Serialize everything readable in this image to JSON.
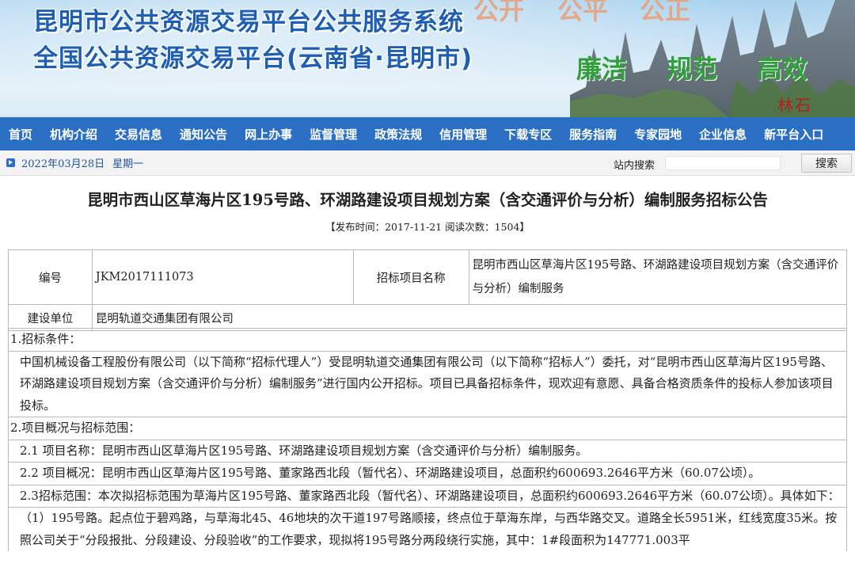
{
  "banner": {
    "title_line1": "昆明市公共资源交易平台公共服务系统",
    "title_line2": "全国公共资源交易平台(云南省·昆明市)",
    "motto": [
      "公开",
      "公平",
      "公正"
    ],
    "virtues": [
      "廉洁",
      "规范",
      "高效"
    ],
    "stamp": "林石"
  },
  "nav": {
    "items": [
      "首页",
      "机构介绍",
      "交易信息",
      "通知公告",
      "网上办事",
      "监督管理",
      "政策法规",
      "信用管理",
      "下载专区",
      "服务指南",
      "专家园地",
      "企业信息",
      "新平台入口"
    ]
  },
  "datebar": {
    "date": "2022年03月28日",
    "weekday": "星期一",
    "search_label": "站内搜索",
    "search_value": "",
    "search_button": "搜索"
  },
  "article": {
    "title": "昆明市西山区草海片区195号路、环湖路建设项目规划方案（含交通评价与分析）编制服务招标公告",
    "meta": "【发布时间：2017-11-21 阅读次数：1504】"
  },
  "table": {
    "number_label": "编号",
    "number_value": "JKM2017111073",
    "project_label": "招标项目名称",
    "project_value": "昆明市西山区草海片区195号路、环湖路建设项目规划方案（含交通评价与分析）编制服务",
    "builder_label": "建设单位",
    "builder_value": "昆明轨道交通集团有限公司"
  },
  "content": {
    "s1_heading": "1.招标条件：",
    "s1_body": "中国机械设备工程股份有限公司（以下简称“招标代理人”）受昆明轨道交通集团有限公司（以下简称“招标人”）委托，对“昆明市西山区草海片区195号路、环湖路建设项目规划方案（含交通评价与分析）编制服务”进行国内公开招标。项目已具备招标条件，现欢迎有意愿、具备合格资质条件的投标人参加该项目投标。",
    "s2_heading": "2.项目概况与招标范围：",
    "s2_1": "2.1 项目名称：昆明市西山区草海片区195号路、环湖路建设项目规划方案（含交通评价与分析）编制服务。",
    "s2_2": "2.2 项目概况：昆明市西山区草海片区195号路、董家路西北段（暂代名）、环湖路建设项目，总面积约600693.2646平方米（60.07公顷）。",
    "s2_3": "2.3招标范围：本次拟招标范围为草海片区195号路、董家路西北段（暂代名）、环湖路建设项目，总面积约600693.2646平方米（60.07公顷）。具体如下：",
    "s2_3_1": "（1）195号路。起点位于碧鸡路，与草海北45、46地块的次干道197号路顺接，终点位于草海东岸，与西华路交叉。道路全长5951米，红线宽度35米。按照公司关于“分段报批、分段建设、分段验收”的工作要求，现拟将195号路分两段绕行实施，其中：1#段面积为147771.003平"
  }
}
